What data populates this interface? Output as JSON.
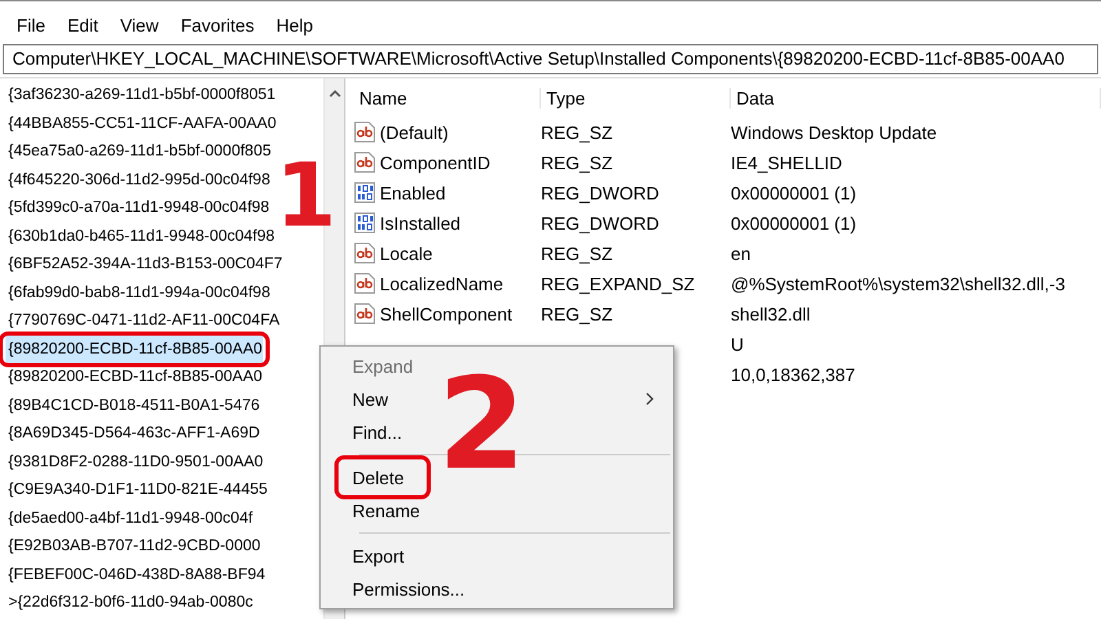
{
  "menu_bar": [
    "File",
    "Edit",
    "View",
    "Favorites",
    "Help"
  ],
  "address_bar": {
    "value": "Computer\\HKEY_LOCAL_MACHINE\\SOFTWARE\\Microsoft\\Active Setup\\Installed Components\\{89820200-ECBD-11cf-8B85-00AA0"
  },
  "tree": {
    "items": [
      {
        "label": "{3af36230-a269-11d1-b5bf-0000f8051",
        "selected": false,
        "highlighted": false
      },
      {
        "label": "{44BBA855-CC51-11CF-AAFA-00AA0",
        "selected": false,
        "highlighted": false
      },
      {
        "label": "{45ea75a0-a269-11d1-b5bf-0000f805",
        "selected": false,
        "highlighted": false
      },
      {
        "label": "{4f645220-306d-11d2-995d-00c04f98",
        "selected": false,
        "highlighted": false
      },
      {
        "label": "{5fd399c0-a70a-11d1-9948-00c04f98",
        "selected": false,
        "highlighted": false
      },
      {
        "label": "{630b1da0-b465-11d1-9948-00c04f98",
        "selected": false,
        "highlighted": false
      },
      {
        "label": "{6BF52A52-394A-11d3-B153-00C04F7",
        "selected": false,
        "highlighted": false
      },
      {
        "label": "{6fab99d0-bab8-11d1-994a-00c04f98",
        "selected": false,
        "highlighted": false
      },
      {
        "label": "{7790769C-0471-11d2-AF11-00C04FA",
        "selected": false,
        "highlighted": false
      },
      {
        "label": "{89820200-ECBD-11cf-8B85-00AA0",
        "selected": true,
        "highlighted": true
      },
      {
        "label": "{89820200-ECBD-11cf-8B85-00AA0",
        "selected": false,
        "highlighted": false
      },
      {
        "label": "{89B4C1CD-B018-4511-B0A1-5476",
        "selected": false,
        "highlighted": false
      },
      {
        "label": "{8A69D345-D564-463c-AFF1-A69D",
        "selected": false,
        "highlighted": false
      },
      {
        "label": "{9381D8F2-0288-11D0-9501-00AA0",
        "selected": false,
        "highlighted": false
      },
      {
        "label": "{C9E9A340-D1F1-11D0-821E-44455",
        "selected": false,
        "highlighted": false
      },
      {
        "label": "{de5aed00-a4bf-11d1-9948-00c04f",
        "selected": false,
        "highlighted": false
      },
      {
        "label": "{E92B03AB-B707-11d2-9CBD-0000",
        "selected": false,
        "highlighted": false
      },
      {
        "label": "{FEBEF00C-046D-438D-8A88-BF94",
        "selected": false,
        "highlighted": false
      },
      {
        "label": ">{22d6f312-b0f6-11d0-94ab-0080c",
        "selected": false,
        "highlighted": false
      }
    ]
  },
  "values": {
    "columns": [
      "Name",
      "Type",
      "Data"
    ],
    "rows": [
      {
        "kind": "string",
        "name": "(Default)",
        "type": "REG_SZ",
        "data": "Windows Desktop Update"
      },
      {
        "kind": "string",
        "name": "ComponentID",
        "type": "REG_SZ",
        "data": "IE4_SHELLID"
      },
      {
        "kind": "binary",
        "name": "Enabled",
        "type": "REG_DWORD",
        "data": "0x00000001 (1)"
      },
      {
        "kind": "binary",
        "name": "IsInstalled",
        "type": "REG_DWORD",
        "data": "0x00000001 (1)"
      },
      {
        "kind": "string",
        "name": "Locale",
        "type": "REG_SZ",
        "data": "en"
      },
      {
        "kind": "string",
        "name": "LocalizedName",
        "type": "REG_EXPAND_SZ",
        "data": "@%SystemRoot%\\system32\\shell32.dll,-3"
      },
      {
        "kind": "string",
        "name": "ShellComponent",
        "type": "REG_SZ",
        "data": "shell32.dll"
      },
      {
        "kind": "hidden",
        "data": "U"
      },
      {
        "kind": "hidden",
        "data": "10,0,18362,387"
      }
    ]
  },
  "context_menu": {
    "items": [
      {
        "kind": "item",
        "label": "Expand",
        "disabled": true,
        "submenu": false,
        "highlighted": false
      },
      {
        "kind": "item",
        "label": "New",
        "disabled": false,
        "submenu": true,
        "highlighted": false
      },
      {
        "kind": "item",
        "label": "Find...",
        "disabled": false,
        "submenu": false,
        "highlighted": false
      },
      {
        "kind": "separator"
      },
      {
        "kind": "item",
        "label": "Delete",
        "disabled": false,
        "submenu": false,
        "highlighted": true
      },
      {
        "kind": "item",
        "label": "Rename",
        "disabled": false,
        "submenu": false,
        "highlighted": false
      },
      {
        "kind": "separator"
      },
      {
        "kind": "item",
        "label": "Export",
        "disabled": false,
        "submenu": false,
        "highlighted": false
      },
      {
        "kind": "item",
        "label": "Permissions...",
        "disabled": false,
        "submenu": false,
        "highlighted": false
      }
    ]
  },
  "annotations": [
    "1",
    "2"
  ]
}
